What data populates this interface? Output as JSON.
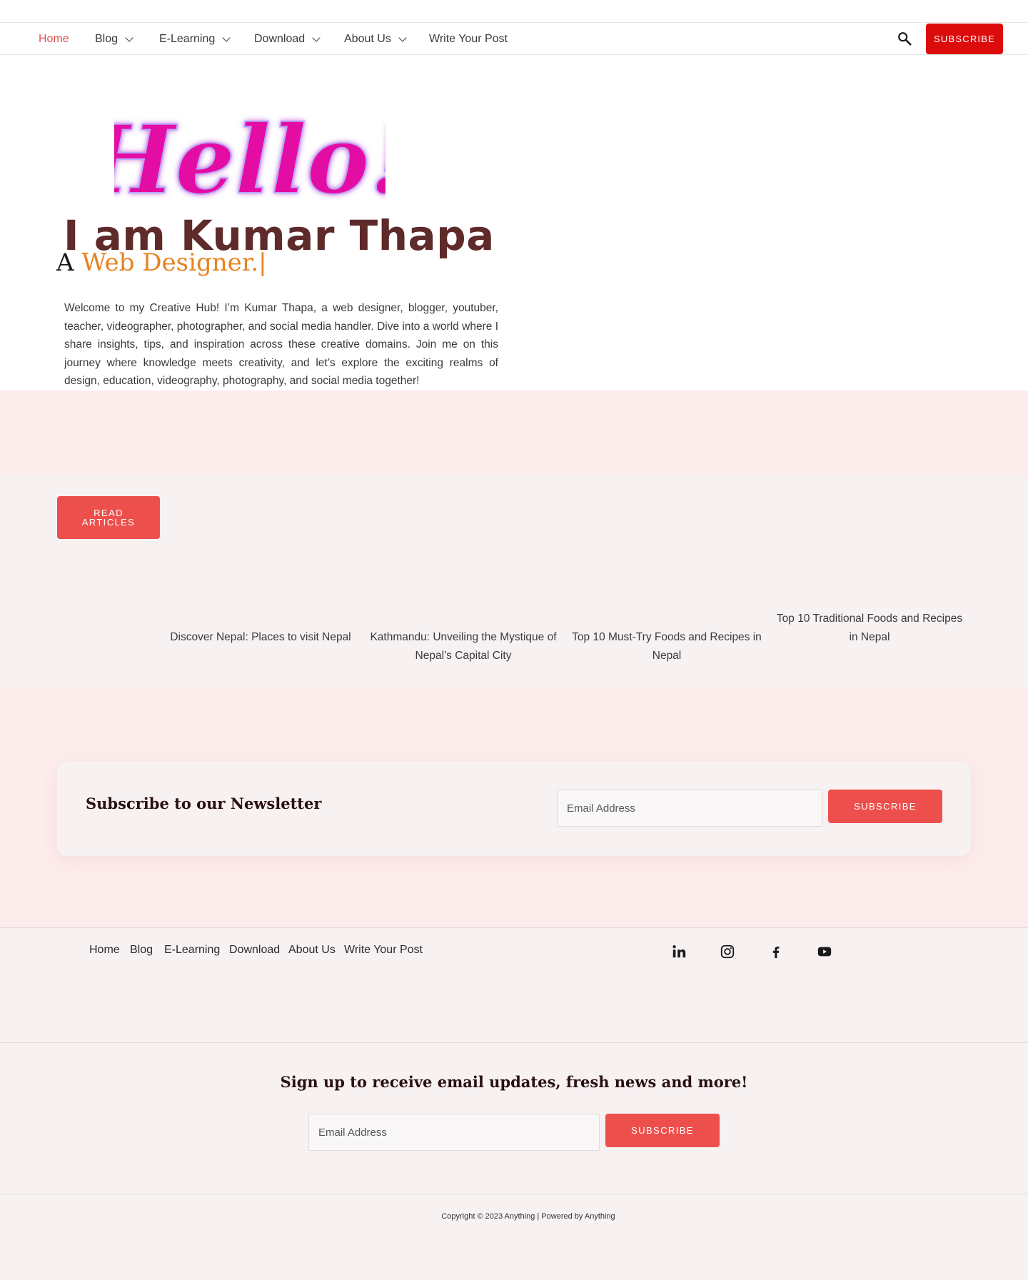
{
  "nav": {
    "items": [
      {
        "label": "Home",
        "dropdown": false,
        "active": true
      },
      {
        "label": "Blog",
        "dropdown": true,
        "active": false
      },
      {
        "label": "E-Learning",
        "dropdown": true,
        "active": false
      },
      {
        "label": "Download",
        "dropdown": true,
        "active": false
      },
      {
        "label": "About Us",
        "dropdown": true,
        "active": false
      },
      {
        "label": "Write Your Post",
        "dropdown": false,
        "active": false
      }
    ],
    "search_icon": "search-icon",
    "subscribe_label": "SUBSCRIBE",
    "subscribe_color": "#dc0c0c"
  },
  "hero": {
    "greeting": "Hello!",
    "greeting_color": "#e40ba4",
    "name": "I am Kumar Thapa",
    "role_prefix": "A ",
    "role": "Web Designer.",
    "cursor": "|",
    "role_color": "#e8821e",
    "intro": "Welcome to my Creative Hub! I’m Kumar Thapa, a web designer, blogger, youtuber, teacher, videographer, photographer, and social media handler. Dive into a world where I share insights, tips, and inspiration across these creative domains. Join me on this journey where knowledge meets creativity, and let’s explore the exciting realms of design, education, videography, photography, and social media together!"
  },
  "articles": {
    "button_label": "READ ARTICLES",
    "posts": [
      {
        "title": "Discover Nepal: Places to visit Nepal"
      },
      {
        "title": "Kathmandu: Unveiling the Mystique of Nepal’s Capital City"
      },
      {
        "title": "Top 10 Must-Try Foods and Recipes in Nepal"
      },
      {
        "title": "Top 10 Traditional Foods and Recipes in Nepal"
      }
    ]
  },
  "newsletter": {
    "title": "Subscribe to our Newsletter",
    "email_placeholder": "Email Address",
    "button_label": "SUBSCRIBE"
  },
  "footer": {
    "nav": [
      "Home",
      "Blog",
      "E-Learning",
      "Download",
      "About Us",
      "Write Your Post"
    ],
    "social_icons": [
      "linkedin-icon",
      "instagram-icon",
      "facebook-icon",
      "youtube-icon"
    ]
  },
  "signup": {
    "title": "Sign up to receive email updates, fresh news and more!",
    "email_placeholder": "Email Address",
    "button_label": "SUBSCRIBE"
  },
  "copyright": "Copyright © 2023 Anything | Powered by Anything",
  "colors": {
    "accent": "#ed504c",
    "name": "#5e2a2a",
    "pink_band": "#fdecec",
    "light_band": "#f7f1f2"
  }
}
